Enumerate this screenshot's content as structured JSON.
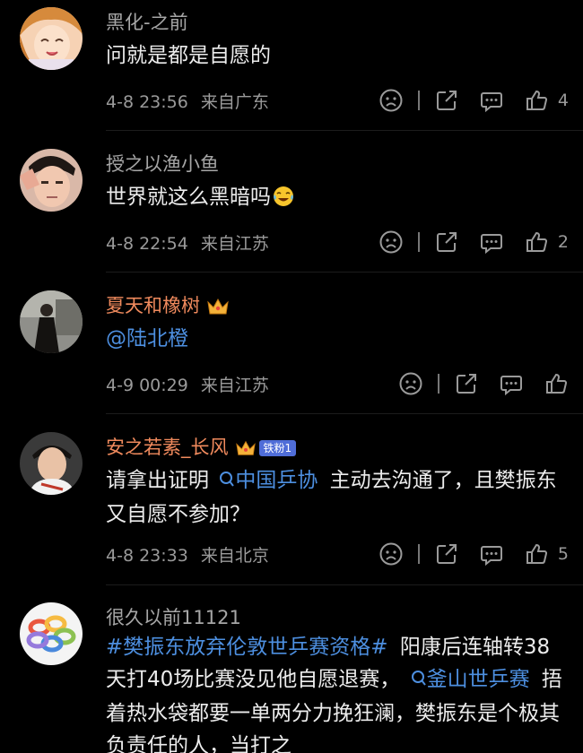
{
  "comments": [
    {
      "username": "黑化-之前",
      "text": "问就是都是自愿的",
      "time": "4-8 23:56",
      "location": "来自广东",
      "likes": "4",
      "avatar": "anime-girl-avatar"
    },
    {
      "username": "授之以渔小鱼",
      "text": "世界就这么黑暗吗",
      "emoji": "crying-laughing-emoji",
      "time": "4-8 22:54",
      "location": "来自江苏",
      "likes": "2",
      "avatar": "boy-saluting-avatar"
    },
    {
      "username": "夏天和橡树",
      "crown": "crown-icon",
      "text": "@陆北橙",
      "time": "4-9 00:29",
      "location": "来自江苏",
      "likes": "",
      "avatar": "girl-in-dress-avatar"
    },
    {
      "username": "安之若素_长风",
      "crown": "crown-icon",
      "fan_badge": "铁粉1",
      "text_pre": "请拿出证明",
      "topic": "中国乒协",
      "text_post": "主动去沟通了，且樊振东又自愿不参加？",
      "time": "4-8 23:33",
      "location": "来自北京",
      "likes": "5",
      "avatar": "young-man-avatar"
    },
    {
      "username": "很久以前11121",
      "hashtag": "#樊振东放弃伦敦世乒赛资格#",
      "text_a": "阳康后连轴转38天打40场比赛没见他自愿退赛，",
      "topic": "釜山世乒赛",
      "text_b": "捂着热水袋都要一单两分力挽狂澜，樊振东是个极其负责任的人，当打之",
      "avatar": "colorful-rings-avatar"
    }
  ],
  "colors": {
    "background": "#000000",
    "link": "#4d8fe0",
    "vip_name": "#f08a5d",
    "meta": "#9a9a9a",
    "text": "#ececec"
  }
}
